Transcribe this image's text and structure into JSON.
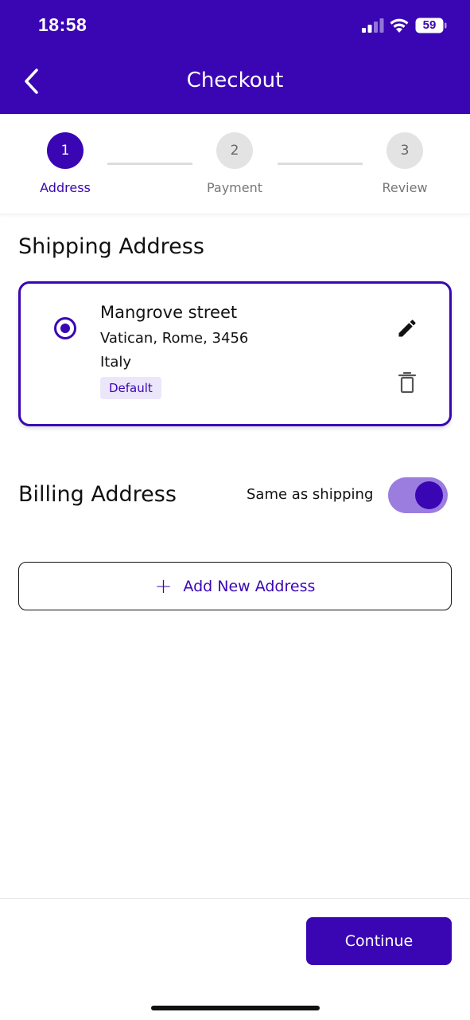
{
  "status_bar": {
    "time": "18:58",
    "battery": "59"
  },
  "header": {
    "title": "Checkout",
    "back_icon": "chevron-left-icon"
  },
  "stepper": {
    "steps": [
      {
        "number": "1",
        "label": "Address",
        "state": "active"
      },
      {
        "number": "2",
        "label": "Payment",
        "state": "inactive"
      },
      {
        "number": "3",
        "label": "Review",
        "state": "inactive"
      }
    ]
  },
  "shipping": {
    "title": "Shipping Address",
    "address": {
      "street": "Mangrove street",
      "city_line": "Vatican, Rome, 3456",
      "country": "Italy",
      "badge": "Default",
      "selected": true
    }
  },
  "billing": {
    "title": "Billing Address",
    "same_as_shipping_label": "Same as shipping",
    "same_as_shipping": true
  },
  "add_address": {
    "label": "Add New Address",
    "icon": "plus-icon"
  },
  "footer": {
    "continue_label": "Continue"
  },
  "colors": {
    "primary": "#3a06b3",
    "toggle_track": "#9b7de0",
    "badge_bg": "#ece6fb"
  }
}
